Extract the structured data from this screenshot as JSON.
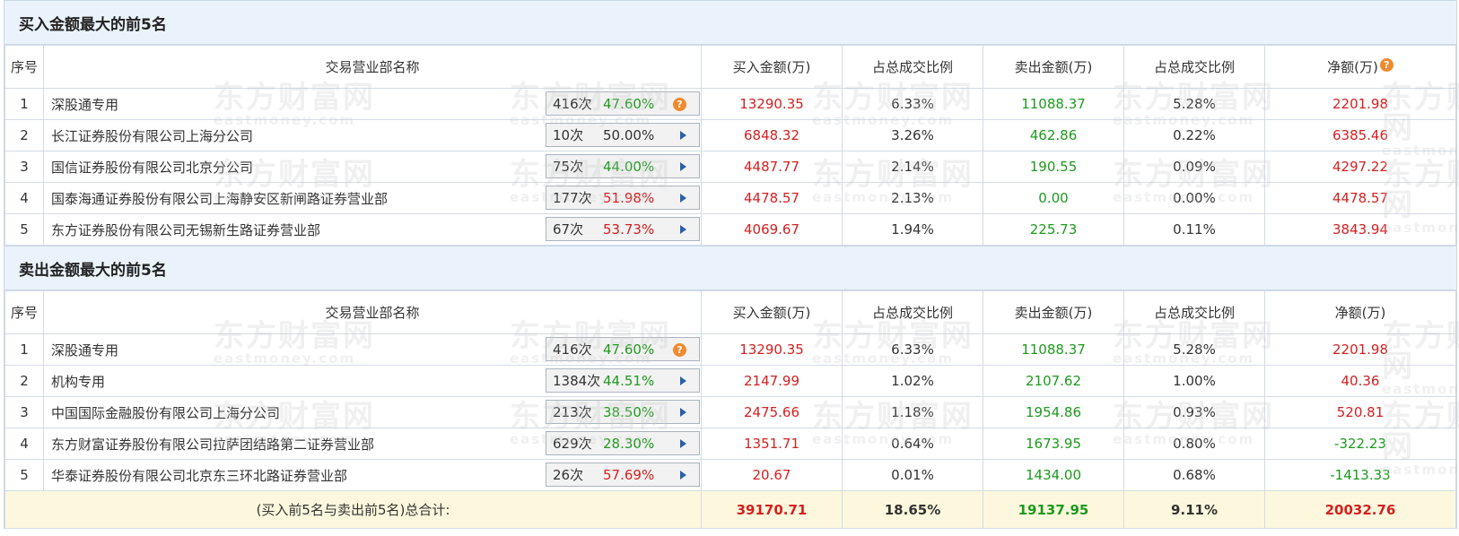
{
  "watermark": {
    "cn": "东方财富网",
    "en": "eastmoney.com"
  },
  "headers": {
    "idx": "序号",
    "name": "交易营业部名称",
    "buy": "买入金额(万)",
    "buy_ratio": "占总成交比例",
    "sell": "卖出金额(万)",
    "sell_ratio": "占总成交比例",
    "net": "净额(万)"
  },
  "buy_section": {
    "title": "买入金额最大的前5名",
    "rows": [
      {
        "idx": "1",
        "name": "深股通专用",
        "count": "416次",
        "pct": "47.60%",
        "pct_color": "green",
        "icon": "question",
        "buy": "13290.35",
        "buy_ratio": "6.33%",
        "sell": "11088.37",
        "sell_ratio": "5.28%",
        "net": "2201.98"
      },
      {
        "idx": "2",
        "name": "长江证券股份有限公司上海分公司",
        "count": "10次",
        "pct": "50.00%",
        "pct_color": "plain",
        "icon": "arrow",
        "buy": "6848.32",
        "buy_ratio": "3.26%",
        "sell": "462.86",
        "sell_ratio": "0.22%",
        "net": "6385.46"
      },
      {
        "idx": "3",
        "name": "国信证券股份有限公司北京分公司",
        "count": "75次",
        "pct": "44.00%",
        "pct_color": "green",
        "icon": "arrow",
        "buy": "4487.77",
        "buy_ratio": "2.14%",
        "sell": "190.55",
        "sell_ratio": "0.09%",
        "net": "4297.22"
      },
      {
        "idx": "4",
        "name": "国泰海通证券股份有限公司上海静安区新闸路证券营业部",
        "count": "177次",
        "pct": "51.98%",
        "pct_color": "red",
        "icon": "arrow",
        "buy": "4478.57",
        "buy_ratio": "2.13%",
        "sell": "0.00",
        "sell_ratio": "0.00%",
        "net": "4478.57"
      },
      {
        "idx": "5",
        "name": "东方证券股份有限公司无锡新生路证券营业部",
        "count": "67次",
        "pct": "53.73%",
        "pct_color": "red",
        "icon": "arrow",
        "buy": "4069.67",
        "buy_ratio": "1.94%",
        "sell": "225.73",
        "sell_ratio": "0.11%",
        "net": "3843.94"
      }
    ]
  },
  "sell_section": {
    "title": "卖出金额最大的前5名",
    "rows": [
      {
        "idx": "1",
        "name": "深股通专用",
        "count": "416次",
        "pct": "47.60%",
        "pct_color": "green",
        "icon": "question",
        "buy": "13290.35",
        "buy_ratio": "6.33%",
        "sell": "11088.37",
        "sell_ratio": "5.28%",
        "net": "2201.98"
      },
      {
        "idx": "2",
        "name": "机构专用",
        "count": "1384次",
        "pct": "44.51%",
        "pct_color": "green",
        "icon": "arrow",
        "buy": "2147.99",
        "buy_ratio": "1.02%",
        "sell": "2107.62",
        "sell_ratio": "1.00%",
        "net": "40.36"
      },
      {
        "idx": "3",
        "name": "中国国际金融股份有限公司上海分公司",
        "count": "213次",
        "pct": "38.50%",
        "pct_color": "green",
        "icon": "arrow",
        "buy": "2475.66",
        "buy_ratio": "1.18%",
        "sell": "1954.86",
        "sell_ratio": "0.93%",
        "net": "520.81"
      },
      {
        "idx": "4",
        "name": "东方财富证券股份有限公司拉萨团结路第二证券营业部",
        "count": "629次",
        "pct": "28.30%",
        "pct_color": "green",
        "icon": "arrow",
        "buy": "1351.71",
        "buy_ratio": "0.64%",
        "sell": "1673.95",
        "sell_ratio": "0.80%",
        "net": "-322.23"
      },
      {
        "idx": "5",
        "name": "华泰证券股份有限公司北京东三环北路证券营业部",
        "count": "26次",
        "pct": "57.69%",
        "pct_color": "red",
        "icon": "arrow",
        "buy": "20.67",
        "buy_ratio": "0.01%",
        "sell": "1434.00",
        "sell_ratio": "0.68%",
        "net": "-1413.33"
      }
    ]
  },
  "total": {
    "label": "(买入前5名与卖出前5名)总合计:",
    "buy": "39170.71",
    "buy_ratio": "18.65%",
    "sell": "19137.95",
    "sell_ratio": "9.11%",
    "net": "20032.76"
  },
  "colors": {
    "red": "#d42020",
    "green": "#1d9a1d",
    "header_bg": "#eaf3fb",
    "total_bg": "#fdf8dd"
  }
}
